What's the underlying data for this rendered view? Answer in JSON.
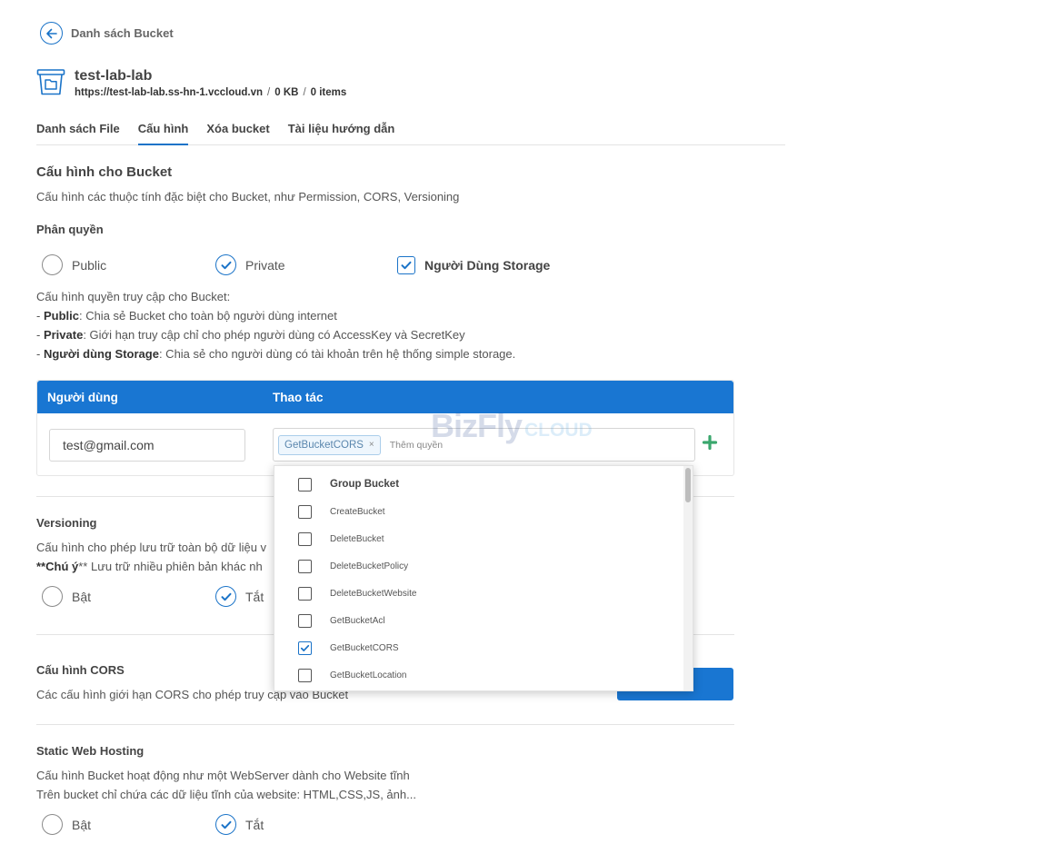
{
  "header": {
    "back_label": "Danh sách Bucket",
    "bucket_name": "test-lab-lab",
    "bucket_url": "https://test-lab-lab.ss-hn-1.vccloud.vn",
    "bucket_size": "0 KB",
    "bucket_items": "0 items",
    "separator": "/"
  },
  "tabs": [
    {
      "label": "Danh sách File",
      "active": false
    },
    {
      "label": "Cấu hình",
      "active": true
    },
    {
      "label": "Xóa bucket",
      "active": false
    },
    {
      "label": "Tài liệu hướng dẫn",
      "active": false
    }
  ],
  "config": {
    "title": "Cấu hình cho Bucket",
    "description": "Cấu hình các thuộc tính đặc biệt cho Bucket, như Permission, CORS, Versioning"
  },
  "permission": {
    "title": "Phân quyền",
    "options": [
      {
        "label": "Public",
        "selected": false
      },
      {
        "label": "Private",
        "selected": true
      },
      {
        "label": "Người Dùng Storage",
        "selected": true
      }
    ],
    "intro": "Cấu hình quyền truy cập cho Bucket:",
    "lines": [
      {
        "term": "Public",
        "text": ": Chia sẻ Bucket cho toàn bộ người dùng internet"
      },
      {
        "term": "Private",
        "text": ": Giới hạn truy cập chỉ cho phép người dùng có AccessKey và SecretKey"
      },
      {
        "term": "Người dùng Storage",
        "text": ": Chia sẻ cho người dùng có tài khoản trên hệ thống simple storage."
      }
    ],
    "bullet_prefix": "- ",
    "table": {
      "col_user": "Người dùng",
      "col_action": "Thao tác",
      "email": "test@gmail.com",
      "tag": "GetBucketCORS",
      "tag_remove": "×",
      "placeholder": "Thêm quyền"
    }
  },
  "dropdown": {
    "items": [
      {
        "label": "Group Bucket",
        "checked": false,
        "group": true
      },
      {
        "label": "CreateBucket",
        "checked": false
      },
      {
        "label": "DeleteBucket",
        "checked": false
      },
      {
        "label": "DeleteBucketPolicy",
        "checked": false
      },
      {
        "label": "DeleteBucketWebsite",
        "checked": false
      },
      {
        "label": "GetBucketAcl",
        "checked": false
      },
      {
        "label": "GetBucketCORS",
        "checked": true
      },
      {
        "label": "GetBucketLocation",
        "checked": false
      }
    ]
  },
  "versioning": {
    "title": "Versioning",
    "line1": "Cấu hình cho phép lưu trữ toàn bộ dữ liệu v",
    "note_prefix": "**",
    "note_bold": "Chú ý",
    "note_rest": "** Lưu trữ nhiều phiên bản khác nh",
    "on_label": "Bật",
    "off_label": "Tắt",
    "selected": "off"
  },
  "cors": {
    "title": "Cấu hình CORS",
    "description": "Các cấu hình giới hạn CORS cho phép truy cập vào Bucket"
  },
  "static_hosting": {
    "title": "Static Web Hosting",
    "line1": "Cấu hình Bucket hoạt động như một WebServer dành cho Website tĩnh",
    "line2": "Trên bucket chỉ chứa các dữ liệu tĩnh của website: HTML,CSS,JS, ảnh...",
    "on_label": "Bật",
    "off_label": "Tắt",
    "selected": "off"
  },
  "watermark": {
    "part1": "BizFly",
    "part2": "CLOUD"
  },
  "colors": {
    "primary": "#1976d2",
    "add_green": "#3aa76d"
  }
}
